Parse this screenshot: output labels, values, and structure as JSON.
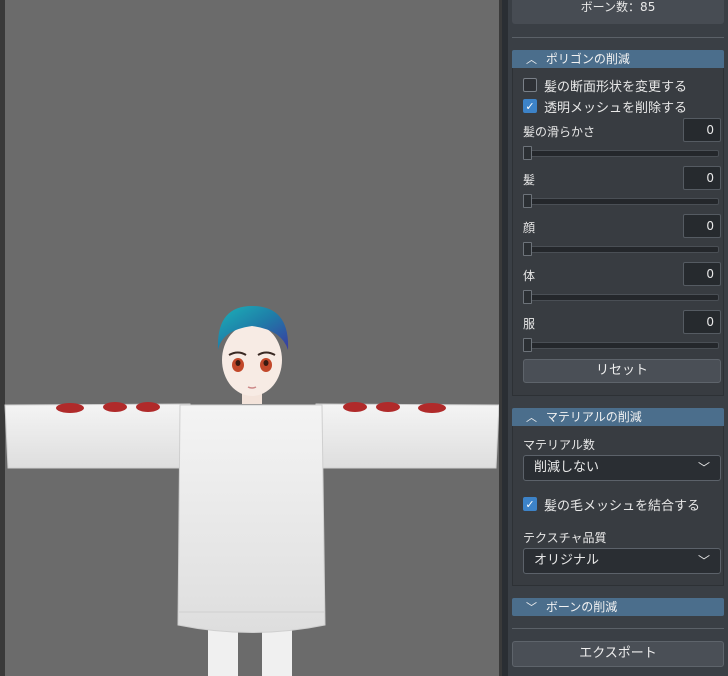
{
  "panel": {
    "bone_count_label": "ボーン数：85",
    "polygon": {
      "title": "ポリゴンの削減",
      "hair_cross_section": {
        "label": "髪の断面形状を変更する",
        "checked": false
      },
      "remove_transparent": {
        "label": "透明メッシュを削除する",
        "checked": true
      },
      "sliders": [
        {
          "label": "髪の滑らかさ",
          "value": "0"
        },
        {
          "label": "髪",
          "value": "0"
        },
        {
          "label": "顔",
          "value": "0"
        },
        {
          "label": "体",
          "value": "0"
        },
        {
          "label": "服",
          "value": "0"
        }
      ],
      "reset_label": "リセット"
    },
    "material": {
      "title": "マテリアルの削減",
      "count_label": "マテリアル数",
      "count_value": "削減しない",
      "merge_hair": {
        "label": "髪の毛メッシュを結合する",
        "checked": true
      },
      "texture_label": "テクスチャ品質",
      "texture_value": "オリジナル"
    },
    "bone": {
      "title": "ボーンの削減"
    },
    "export_label": "エクスポート"
  },
  "colors": {
    "viewport_bg": "#6b6b6b",
    "panel_bg": "#3a3f45",
    "header_accent": "#4b6e8c",
    "checkbox_accent": "#3d83c8",
    "hair": "#1f8aa8"
  },
  "icons": {
    "section_open": "chevron-up-icon",
    "section_closed": "chevron-down-icon",
    "select": "chevron-down-icon",
    "check": "check-icon"
  }
}
